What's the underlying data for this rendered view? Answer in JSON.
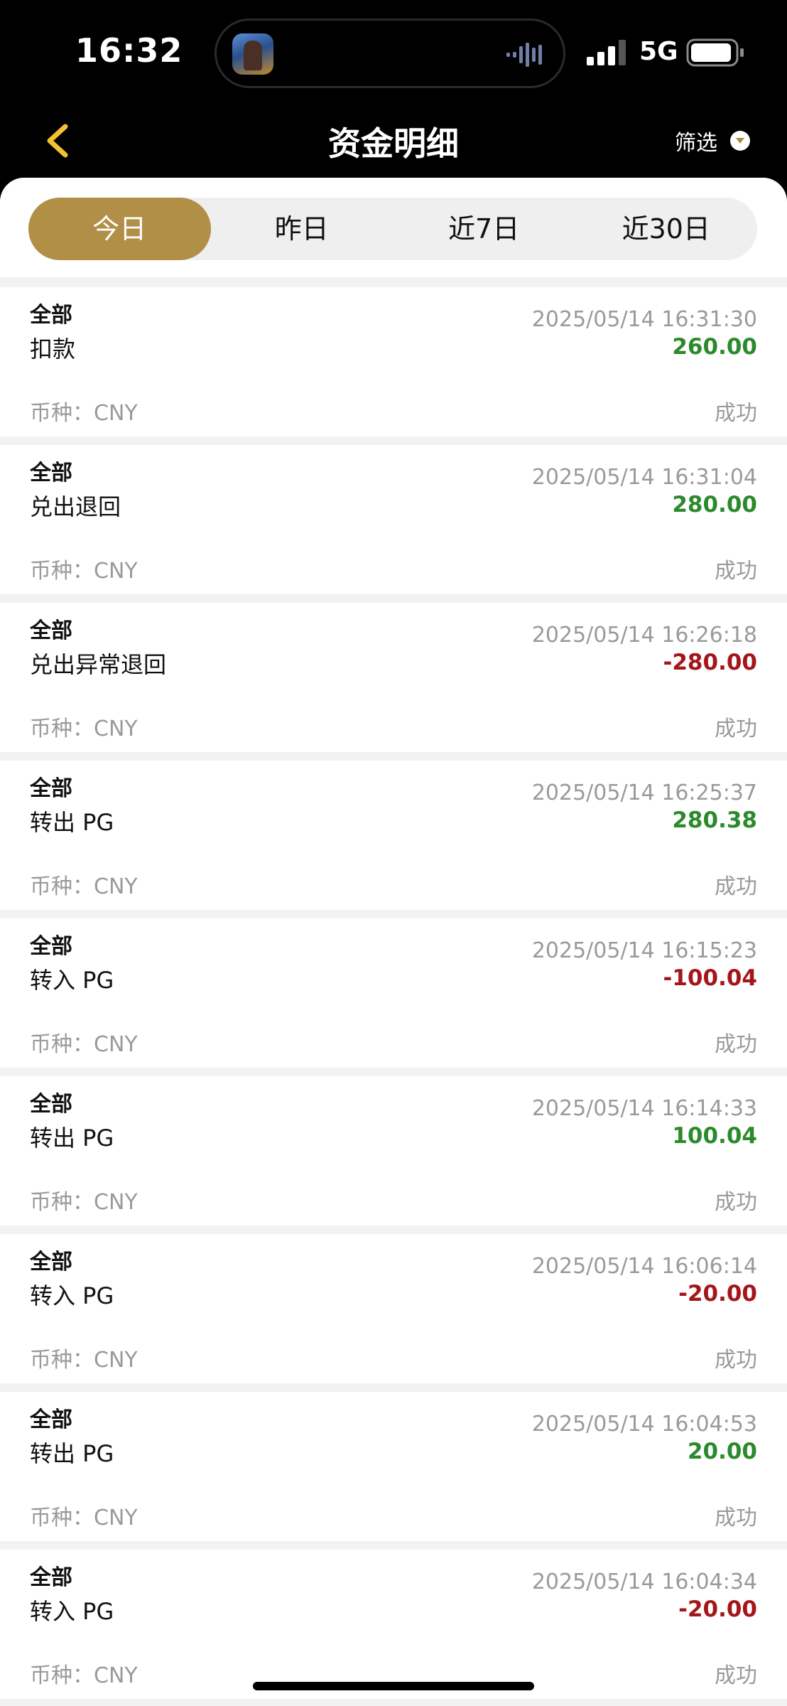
{
  "status_bar": {
    "time": "16:32",
    "network": "5G"
  },
  "nav": {
    "title": "资金明细",
    "filter_label": "筛选"
  },
  "tabs": [
    {
      "label": "今日",
      "active": true
    },
    {
      "label": "昨日",
      "active": false
    },
    {
      "label": "近7日",
      "active": false
    },
    {
      "label": "近30日",
      "active": false
    }
  ],
  "records": [
    {
      "category": "全部",
      "type": "扣款",
      "time": "2025/05/14 16:31:30",
      "amount": "260.00",
      "sign": "pos",
      "currency": "币种：CNY",
      "status": "成功"
    },
    {
      "category": "全部",
      "type": "兑出退回",
      "time": "2025/05/14 16:31:04",
      "amount": "280.00",
      "sign": "pos",
      "currency": "币种：CNY",
      "status": "成功"
    },
    {
      "category": "全部",
      "type": "兑出异常退回",
      "time": "2025/05/14 16:26:18",
      "amount": "-280.00",
      "sign": "neg",
      "currency": "币种：CNY",
      "status": "成功"
    },
    {
      "category": "全部",
      "type": "转出 PG",
      "time": "2025/05/14 16:25:37",
      "amount": "280.38",
      "sign": "pos",
      "currency": "币种：CNY",
      "status": "成功"
    },
    {
      "category": "全部",
      "type": "转入 PG",
      "time": "2025/05/14 16:15:23",
      "amount": "-100.04",
      "sign": "neg",
      "currency": "币种：CNY",
      "status": "成功"
    },
    {
      "category": "全部",
      "type": "转出 PG",
      "time": "2025/05/14 16:14:33",
      "amount": "100.04",
      "sign": "pos",
      "currency": "币种：CNY",
      "status": "成功"
    },
    {
      "category": "全部",
      "type": "转入 PG",
      "time": "2025/05/14 16:06:14",
      "amount": "-20.00",
      "sign": "neg",
      "currency": "币种：CNY",
      "status": "成功"
    },
    {
      "category": "全部",
      "type": "转出 PG",
      "time": "2025/05/14 16:04:53",
      "amount": "20.00",
      "sign": "pos",
      "currency": "币种：CNY",
      "status": "成功"
    },
    {
      "category": "全部",
      "type": "转入 PG",
      "time": "2025/05/14 16:04:34",
      "amount": "-20.00",
      "sign": "neg",
      "currency": "币种：CNY",
      "status": "成功"
    }
  ],
  "colors": {
    "accent_gold": "#b18f46",
    "back_arrow": "#f2c230",
    "positive": "#2b8a2b",
    "negative": "#a4161a"
  }
}
